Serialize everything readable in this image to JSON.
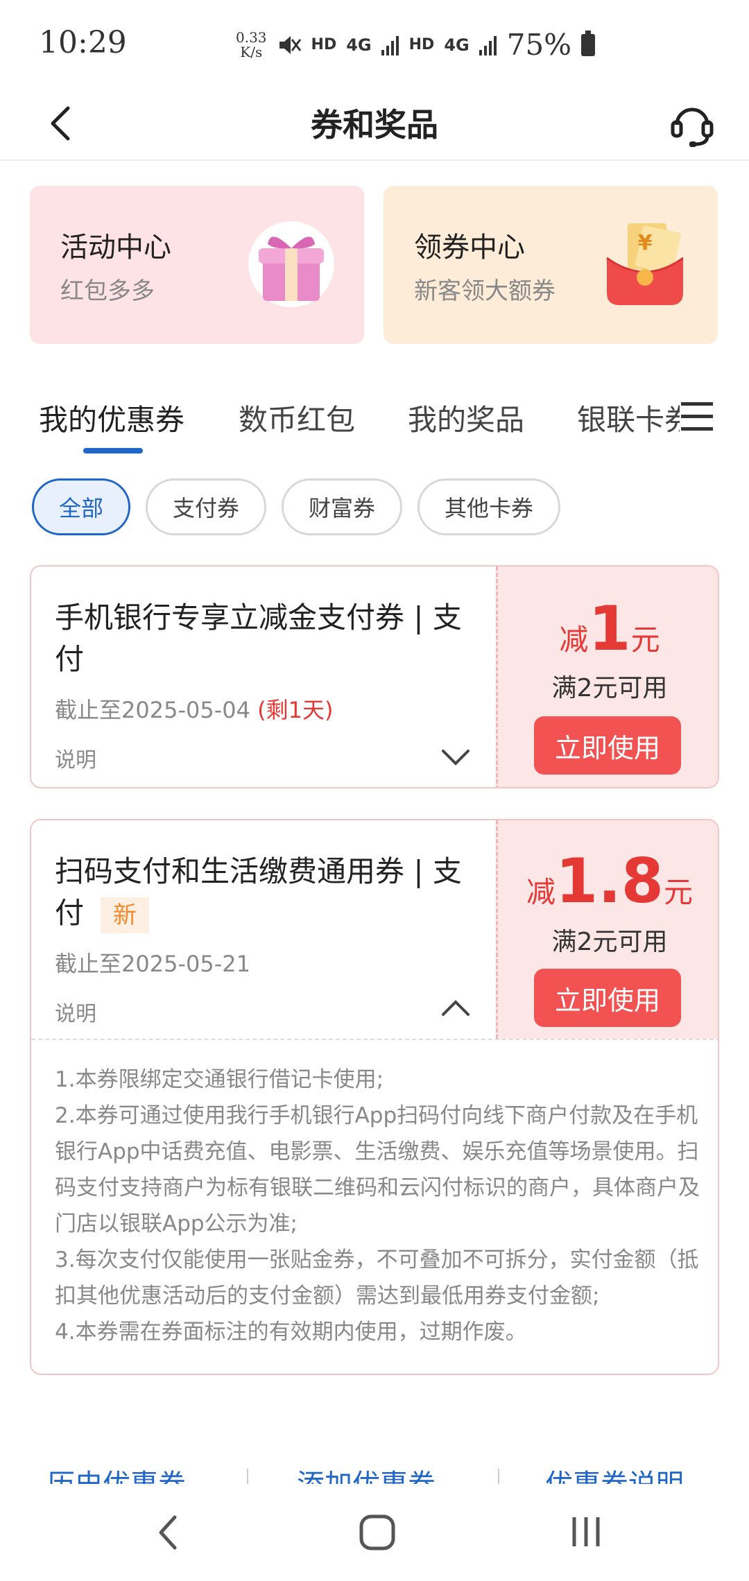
{
  "status_bar": {
    "time": "10:29",
    "net_speed_value": "0.33",
    "net_speed_unit": "K/s",
    "hd1": "HD",
    "sig1": "4G",
    "hd2": "HD",
    "sig2": "4G",
    "battery": "75%"
  },
  "header": {
    "title": "券和奖品"
  },
  "entries": [
    {
      "title": "活动中心",
      "subtitle": "红包多多"
    },
    {
      "title": "领券中心",
      "subtitle": "新客领大额券"
    }
  ],
  "tabs": [
    {
      "label": "我的优惠券"
    },
    {
      "label": "数币红包"
    },
    {
      "label": "我的奖品"
    },
    {
      "label": "银联卡券"
    }
  ],
  "chips": [
    {
      "label": "全部"
    },
    {
      "label": "支付券"
    },
    {
      "label": "财富券"
    },
    {
      "label": "其他卡券"
    }
  ],
  "coupons": [
    {
      "name": "手机银行专享立减金支付券 | 支付",
      "date": "截止至2025-05-04",
      "remain": "(剩1天)",
      "desc_label": "说明",
      "amount_prefix": "减",
      "amount": "1",
      "amount_suffix": "元",
      "condition": "满2元可用",
      "button": "立即使用"
    },
    {
      "name": "扫码支付和生活缴费通用券 | 支付",
      "badge": "新",
      "date": "截止至2025-05-21",
      "desc_label": "说明",
      "amount_prefix": "减",
      "amount": "1.8",
      "amount_suffix": "元",
      "condition": "满2元可用",
      "button": "立即使用",
      "rules": [
        "1.本券限绑定交通银行借记卡使用;",
        "2.本券可通过使用我行手机银行App扫码付向线下商户付款及在手机银行App中话费充值、电影票、生活缴费、娱乐充值等场景使用。扫码支付支持商户为标有银联二维码和云闪付标识的商户，具体商户及门店以银联App公示为准;",
        "3.每次支付仅能使用一张贴金券，不可叠加不可拆分，实付金额（抵扣其他优惠活动后的支付金额）需达到最低用券支付金额;",
        "4.本券需在券面标注的有效期内使用，过期作废。"
      ]
    }
  ],
  "bottom_links": [
    {
      "label": "历史优惠券"
    },
    {
      "label": "添加优惠券"
    },
    {
      "label": "优惠券说明"
    }
  ],
  "colors": {
    "accent": "#1f66c7",
    "coupon_red": "#f25252",
    "amount_red": "#e53935",
    "entry_pink": "#fde3e6",
    "entry_peach": "#fdecd8"
  }
}
